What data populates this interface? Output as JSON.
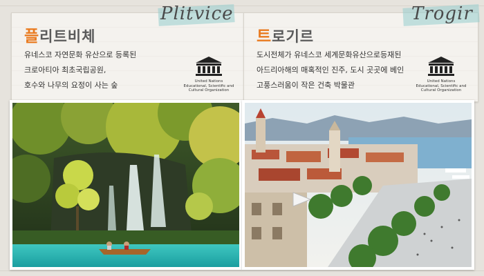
{
  "cards": [
    {
      "script_title": "Plitvice",
      "title_first": "플",
      "title_rest": "리트비체",
      "lines": [
        "유네스코 자연문화 유산으로 등록된",
        "크로아티아 최초국립공원,",
        "호수와 나무의 요정이 사는 숲"
      ],
      "logo_word": "UNESCO",
      "logo_caption": [
        "United Nations",
        "Educational, Scientific and",
        "Cultural Organization"
      ],
      "photo_icon": "waterfall-lake-photo"
    },
    {
      "script_title": "Trogir",
      "title_first": "트",
      "title_rest": "로기르",
      "lines": [
        "도시전체가 유네스코 세계문화유산으로등재된",
        "아드리아해의 매혹적인 진주, 도시 곳곳에 베인",
        "고풍스러움이 작은 건축 박물관"
      ],
      "logo_word": "UNESCO",
      "logo_caption": [
        "United Nations",
        "Educational, Scientific and",
        "Cultural Organization"
      ],
      "photo_icon": "coastal-town-photo"
    }
  ],
  "colors": {
    "accent": "#e97a1f",
    "tape": "#96cdcd"
  }
}
